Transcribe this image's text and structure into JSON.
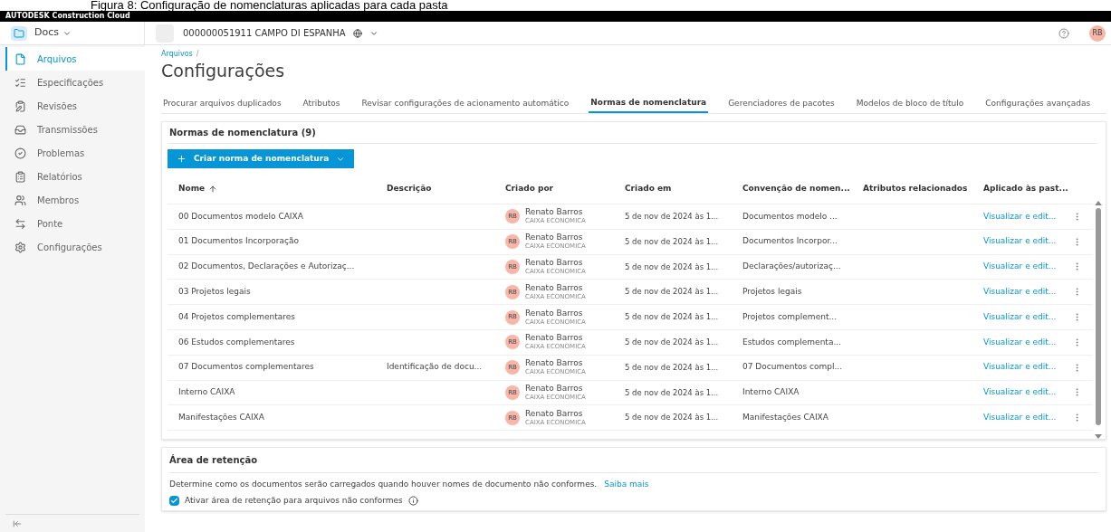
{
  "caption": "Figura 8: Configuração de nomenclaturas aplicadas para cada pasta",
  "brand": "AUTODESK Construction Cloud",
  "app_switcher": {
    "label": "Docs"
  },
  "project": {
    "name": "000000051911 CAMPO DI ESPANHA"
  },
  "user": {
    "initials": "RB"
  },
  "sidebar": {
    "items": [
      {
        "label": "Arquivos",
        "selected": true
      },
      {
        "label": "Especificações",
        "selected": false
      },
      {
        "label": "Revisões",
        "selected": false
      },
      {
        "label": "Transmissões",
        "selected": false
      },
      {
        "label": "Problemas",
        "selected": false
      },
      {
        "label": "Relatórios",
        "selected": false
      },
      {
        "label": "Membros",
        "selected": false
      },
      {
        "label": "Ponte",
        "selected": false
      },
      {
        "label": "Configurações",
        "selected": false
      }
    ]
  },
  "breadcrumb": "Arquivos",
  "breadcrumb_separator": "/",
  "title": "Configurações",
  "tabs": [
    {
      "label": "Procurar arquivos duplicados",
      "selected": false
    },
    {
      "label": "Atributos",
      "selected": false
    },
    {
      "label": "Revisar configurações de acionamento automático",
      "selected": false
    },
    {
      "label": "Normas de nomenclatura",
      "selected": true
    },
    {
      "label": "Gerenciadores de pacotes",
      "selected": false
    },
    {
      "label": "Modelos de bloco de título",
      "selected": false
    },
    {
      "label": "Configurações avançadas",
      "selected": false
    }
  ],
  "naming": {
    "title": "Normas de nomenclatura (9)",
    "create_button": "Criar norma de nomenclatura",
    "columns": [
      "Nome",
      "Descrição",
      "Criado por",
      "Criado em",
      "Convenção de nomen...",
      "Atributos relacionados",
      "Aplicado às past..."
    ],
    "rows": [
      {
        "name": "00 Documentos modelo CAIXA",
        "initials": "RB",
        "creator": "Renato Barros",
        "company": "CAIXA ECONOMICA",
        "created": "5 de nov de 2024 às 1...",
        "convention": "Documentos modelo ...",
        "applied": "Visualizar e edit..."
      },
      {
        "name": "01 Documentos Incorporação",
        "initials": "RB",
        "creator": "Renato Barros",
        "company": "CAIXA ECONOMICA",
        "created": "5 de nov de 2024 às 1...",
        "convention": "Documentos Incorpor...",
        "applied": "Visualizar e edit..."
      },
      {
        "name": "02 Documentos, Declarações e Autorizaç...",
        "initials": "RB",
        "creator": "Renato Barros",
        "company": "CAIXA ECONOMICA",
        "created": "5 de nov de 2024 às 1...",
        "convention": "Declarações/autorizaç...",
        "applied": "Visualizar e edit..."
      },
      {
        "name": "03 Projetos legais",
        "initials": "RB",
        "creator": "Renato Barros",
        "company": "CAIXA ECONOMICA",
        "created": "5 de nov de 2024 às 1...",
        "convention": "Projetos legais",
        "applied": "Visualizar e edit..."
      },
      {
        "name": "04 Projetos complementares",
        "initials": "RB",
        "creator": "Renato Barros",
        "company": "CAIXA ECONOMICA",
        "created": "5 de nov de 2024 às 1...",
        "convention": "Projetos complement...",
        "applied": "Visualizar e edit..."
      },
      {
        "name": "06 Estudos complementares",
        "initials": "RB",
        "creator": "Renato Barros",
        "company": "CAIXA ECONOMICA",
        "created": "5 de nov de 2024 às 1...",
        "convention": "Estudos complementa...",
        "applied": "Visualizar e edit..."
      },
      {
        "name": "07 Documentos complementares",
        "description": "Identificação de docu...",
        "initials": "RB",
        "creator": "Renato Barros",
        "company": "CAIXA ECONOMICA",
        "created": "5 de nov de 2024 às 1...",
        "convention": "07 Documentos compl...",
        "applied": "Visualizar e edit..."
      },
      {
        "name": "Interno CAIXA",
        "initials": "RB",
        "creator": "Renato Barros",
        "company": "CAIXA ECONOMICA",
        "created": "5 de nov de 2024 às 1...",
        "convention": "Interno CAIXA",
        "applied": "Visualizar e edit..."
      },
      {
        "name": "Manifestações CAIXA",
        "initials": "RB",
        "creator": "Renato Barros",
        "company": "CAIXA ECONOMICA",
        "created": "5 de nov de 2024 às 1...",
        "convention": "Manifestações CAIXA",
        "applied": "Visualizar e edit..."
      }
    ]
  },
  "retention": {
    "title": "Área de retenção",
    "text": "Determine como os documentos serão carregados quando houver nomes de documento não conformes.",
    "link": "Saiba mais",
    "checkbox": {
      "label": "Ativar área de retenção para arquivos não conformes",
      "checked": true
    }
  }
}
